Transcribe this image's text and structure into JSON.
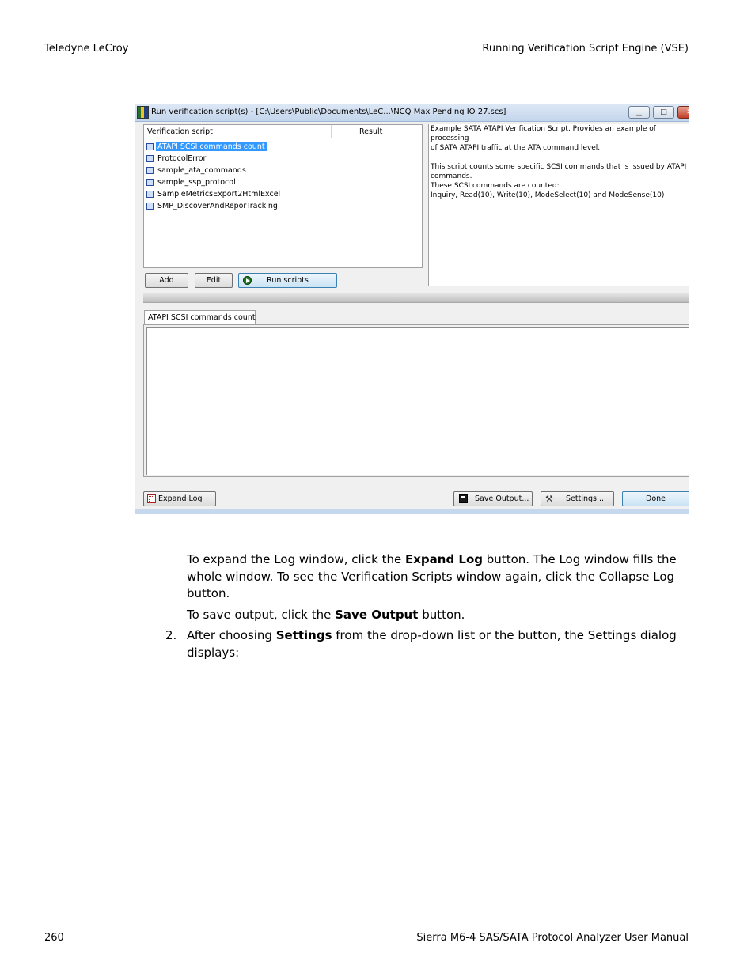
{
  "header": {
    "left": "Teledyne LeCroy",
    "right": "Running Verification Script Engine (VSE)"
  },
  "dialog": {
    "title": "Run verification script(s) - [C:\\Users\\Public\\Documents\\LeC...\\NCQ Max Pending IO 27.scs]",
    "window_buttons": {
      "minimize": "▁",
      "maximize": "□",
      "close": "✕"
    },
    "list": {
      "col_script": "Verification script",
      "col_result": "Result",
      "items": [
        "ATAPI SCSI commands count",
        "ProtocolError",
        "sample_ata_commands",
        "sample_ssp_protocol",
        "SampleMetricsExport2HtmlExcel",
        "SMP_DiscoverAndReporTracking"
      ],
      "selected_index": 0
    },
    "description": [
      "Example SATA ATAPI Verification Script. Provides an example of",
      "processing",
      "of SATA ATAPI traffic at the ATA command level.",
      "",
      "This script counts some specific SCSI commands that is issued by ATAPI",
      "commands.",
      "These SCSI commands are counted:",
      "Inquiry, Read(10), Write(10), ModeSelect(10) and ModeSense(10)"
    ],
    "buttons": {
      "add": "Add",
      "edit": "Edit",
      "run": "Run scripts",
      "expand_log": "Expand Log",
      "save_output": "Save Output...",
      "settings": "Settings...",
      "done": "Done"
    },
    "log_tab": "ATAPI SCSI commands count"
  },
  "body": {
    "p1_a": "To expand the Log window, click the ",
    "p1_b": "Expand Log",
    "p1_c": " button. The Log window fills the whole window. To see the Verification Scripts window again, click the Collapse Log button.",
    "p2_a": "To save output, click the ",
    "p2_b": "Save Output",
    "p2_c": " button.",
    "item2_num": "2.",
    "p3_a": "After choosing ",
    "p3_b": "Settings",
    "p3_c": " from the drop-down list or the button, the Settings dialog displays:"
  },
  "footer": {
    "page_number": "260",
    "manual_title": "Sierra M6-4 SAS/SATA Protocol Analyzer User Manual"
  }
}
